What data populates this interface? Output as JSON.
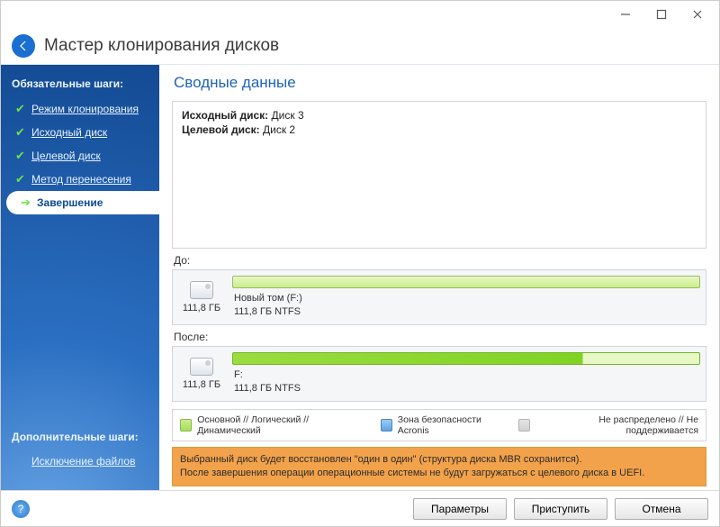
{
  "window": {
    "title": "Мастер клонирования дисков"
  },
  "sidebar": {
    "required_label": "Обязательные шаги:",
    "additional_label": "Дополнительные шаги:",
    "items": [
      {
        "label": "Режим клонирования"
      },
      {
        "label": "Исходный диск"
      },
      {
        "label": "Целевой диск"
      },
      {
        "label": "Метод перенесения"
      },
      {
        "label": "Завершение"
      }
    ],
    "additional_items": [
      {
        "label": "Исключение файлов"
      }
    ]
  },
  "main": {
    "title": "Сводные данные",
    "source_label": "Исходный диск:",
    "source_value": "Диск 3",
    "target_label": "Целевой диск:",
    "target_value": "Диск 2",
    "before_label": "До:",
    "after_label": "После:",
    "before": {
      "size": "111,8 ГБ",
      "name": "Новый том (F:)",
      "details": "111,8 ГБ  NTFS"
    },
    "after": {
      "size": "111,8 ГБ",
      "name": "F:",
      "details": "111,8 ГБ  NTFS"
    },
    "legend": {
      "primary": "Основной // Логический // Динамический",
      "security": "Зона безопасности Acronis",
      "unallocated": "Не распределено // Не поддерживается"
    },
    "warning1": "Выбранный диск будет восстановлен \"один в один\" (структура диска MBR сохранится).",
    "warning2": "После завершения операции операционные системы не будут загружаться с целевого диска в UEFI."
  },
  "footer": {
    "params": "Параметры",
    "proceed": "Приступить",
    "cancel": "Отмена"
  }
}
